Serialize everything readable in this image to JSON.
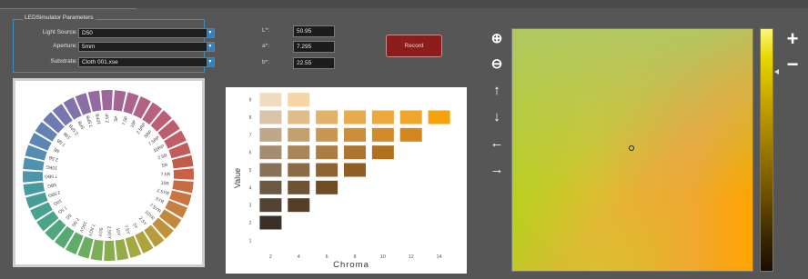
{
  "params": {
    "title": "LEDSimulator Parameters",
    "light_source": {
      "label": "Light Source:",
      "value": "D50"
    },
    "aperture": {
      "label": "Aperture:",
      "value": "5mm"
    },
    "substrate": {
      "label": "Substrate:",
      "value": "Cloth 001.xse"
    }
  },
  "lab": {
    "l": {
      "label": "L*:",
      "value": "50.95"
    },
    "a": {
      "label": "a*:",
      "value": "7.295"
    },
    "b": {
      "label": "b*:",
      "value": "22.55"
    }
  },
  "record_label": "Record",
  "colors": {
    "panel_bg": "#565656",
    "accent": "#3a8fc0",
    "record_bg": "#8d1d1d"
  },
  "wheel": {
    "hue_labels": [
      "5R",
      "7.5R",
      "10R",
      "2.5YR",
      "5YR",
      "7.5YR",
      "10YR",
      "2.5Y",
      "5Y",
      "7.5Y",
      "10Y",
      "2.5GY",
      "5GY",
      "7.5GY",
      "10GY",
      "2.5G",
      "5G",
      "7.5G",
      "10G",
      "2.5BG",
      "5BG",
      "7.5BG",
      "10BG",
      "2.5B",
      "5B",
      "7.5B",
      "10B",
      "2.5PB",
      "5PB",
      "7.5PB",
      "10PB",
      "2.5P",
      "5P",
      "7.5P",
      "10P",
      "2.5RP",
      "5RP",
      "7.5RP",
      "10RP",
      "2.5R"
    ],
    "segment_colors": [
      "#c45a48",
      "#c86148",
      "#c96a45",
      "#ca7442",
      "#c77e3e",
      "#c4883b",
      "#bf923a",
      "#b89b3a",
      "#aea33d",
      "#a3a842",
      "#96ab48",
      "#88ad4f",
      "#7aae57",
      "#6cae60",
      "#5fac6a",
      "#55aa74",
      "#4ea77e",
      "#4aa488",
      "#48a191",
      "#479e99",
      "#489aa1",
      "#4b96a8",
      "#5091ad",
      "#558cb1",
      "#5c86b3",
      "#6481b4",
      "#6d7bb3",
      "#7776b1",
      "#8171ad",
      "#8b6da8",
      "#946aa2",
      "#9c679b",
      "#a46594",
      "#ab648d",
      "#b16285",
      "#b6617e",
      "#ba5f76",
      "#bd5e6e",
      "#c05d65",
      "#c25c5c"
    ]
  },
  "chart_data": {
    "type": "table",
    "title": "",
    "xlabel": "Chroma",
    "ylabel": "Value",
    "x_ticks": [
      2,
      4,
      6,
      8,
      10,
      12,
      14
    ],
    "y_ticks": [
      1,
      2,
      3,
      4,
      5,
      6,
      7,
      8,
      9
    ],
    "chips": [
      {
        "value": 9,
        "chroma": 2,
        "color": "#f1dcc2"
      },
      {
        "value": 9,
        "chroma": 4,
        "color": "#f4d7a5"
      },
      {
        "value": 8,
        "chroma": 2,
        "color": "#d9c3a9"
      },
      {
        "value": 8,
        "chroma": 4,
        "color": "#dfbd89"
      },
      {
        "value": 8,
        "chroma": 6,
        "color": "#e3b26a"
      },
      {
        "value": 8,
        "chroma": 8,
        "color": "#e8ab4d"
      },
      {
        "value": 8,
        "chroma": 10,
        "color": "#eca83a"
      },
      {
        "value": 8,
        "chroma": 12,
        "color": "#f0a62a"
      },
      {
        "value": 8,
        "chroma": 14,
        "color": "#f6a20d"
      },
      {
        "value": 7,
        "chroma": 2,
        "color": "#bfa78c"
      },
      {
        "value": 7,
        "chroma": 4,
        "color": "#c4a06f"
      },
      {
        "value": 7,
        "chroma": 6,
        "color": "#c99752"
      },
      {
        "value": 7,
        "chroma": 8,
        "color": "#cd8e3b"
      },
      {
        "value": 7,
        "chroma": 10,
        "color": "#d28a2a"
      },
      {
        "value": 7,
        "chroma": 12,
        "color": "#d4871e"
      },
      {
        "value": 6,
        "chroma": 2,
        "color": "#a48c72"
      },
      {
        "value": 6,
        "chroma": 4,
        "color": "#a88559"
      },
      {
        "value": 6,
        "chroma": 6,
        "color": "#ab7d43"
      },
      {
        "value": 6,
        "chroma": 8,
        "color": "#ae7530"
      },
      {
        "value": 6,
        "chroma": 10,
        "color": "#b1701f"
      },
      {
        "value": 5,
        "chroma": 2,
        "color": "#887159"
      },
      {
        "value": 5,
        "chroma": 4,
        "color": "#8b6b45"
      },
      {
        "value": 5,
        "chroma": 6,
        "color": "#8e6432"
      },
      {
        "value": 5,
        "chroma": 8,
        "color": "#905d22"
      },
      {
        "value": 4,
        "chroma": 2,
        "color": "#6b5845"
      },
      {
        "value": 4,
        "chroma": 4,
        "color": "#6e5234"
      },
      {
        "value": 4,
        "chroma": 6,
        "color": "#704c24"
      },
      {
        "value": 3,
        "chroma": 2,
        "color": "#524334"
      },
      {
        "value": 3,
        "chroma": 4,
        "color": "#553e28"
      },
      {
        "value": 2,
        "chroma": 2,
        "color": "#3a3027"
      }
    ],
    "xlim": [
      1,
      15
    ],
    "ylim": [
      0.5,
      9.5
    ]
  },
  "nav": {
    "zoom_in": "⊕",
    "zoom_out": "⊖",
    "up": "↑",
    "down": "↓",
    "left": "←",
    "right": "→"
  },
  "lightness": {
    "plus": "+",
    "minus": "−",
    "level": 0.18
  }
}
